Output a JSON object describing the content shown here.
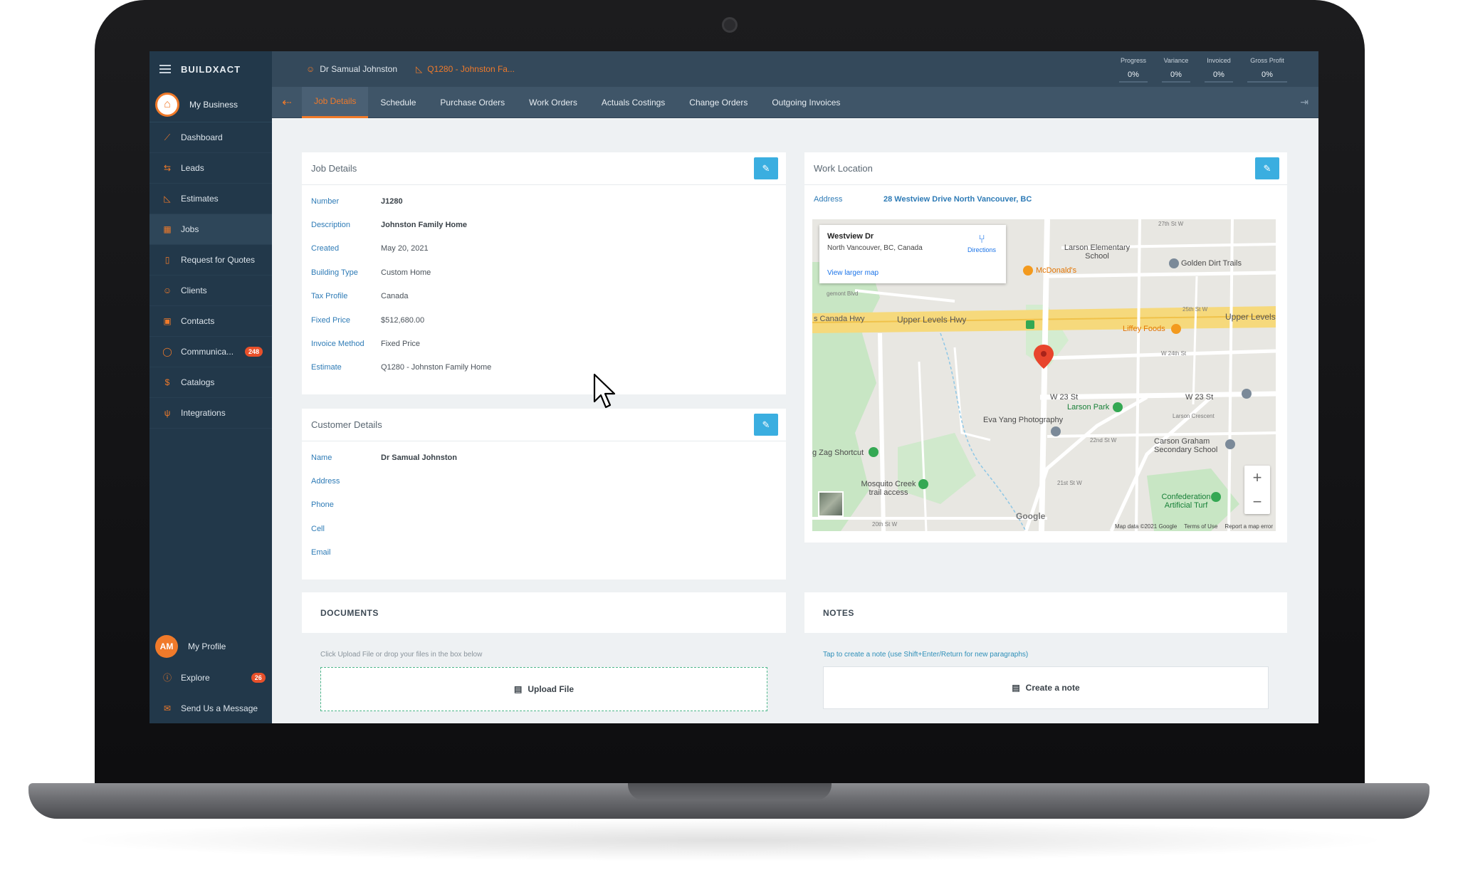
{
  "brand": "BUILDXACT",
  "sidebar": {
    "business_label": "My Business",
    "items": [
      {
        "label": "Dashboard",
        "icon": "chart-line-icon"
      },
      {
        "label": "Leads",
        "icon": "swap-icon"
      },
      {
        "label": "Estimates",
        "icon": "ruler-icon"
      },
      {
        "label": "Jobs",
        "icon": "calendar-icon",
        "active": true
      },
      {
        "label": "Request for Quotes",
        "icon": "document-icon"
      },
      {
        "label": "Clients",
        "icon": "person-icon"
      },
      {
        "label": "Contacts",
        "icon": "address-book-icon"
      },
      {
        "label": "Communica...",
        "icon": "chat-icon",
        "badge": "248"
      },
      {
        "label": "Catalogs",
        "icon": "dollar-icon"
      },
      {
        "label": "Integrations",
        "icon": "plug-icon"
      }
    ],
    "profile": {
      "initials": "AM",
      "label": "My Profile"
    },
    "explore": {
      "label": "Explore",
      "badge": "26"
    },
    "message": {
      "label": "Send Us a Message"
    }
  },
  "topbar": {
    "client_name": "Dr Samual Johnston",
    "job_name": "Q1280 - Johnston Fa...",
    "stats": [
      {
        "label": "Progress",
        "value": "0%"
      },
      {
        "label": "Variance",
        "value": "0%"
      },
      {
        "label": "Invoiced",
        "value": "0%"
      },
      {
        "label": "Gross Profit",
        "value": "0%"
      }
    ]
  },
  "tabs": [
    "Job Details",
    "Schedule",
    "Purchase Orders",
    "Work Orders",
    "Actuals Costings",
    "Change Orders",
    "Outgoing Invoices"
  ],
  "job_details": {
    "title": "Job Details",
    "fields": [
      {
        "label": "Number",
        "value": "J1280",
        "bold": true
      },
      {
        "label": "Description",
        "value": "Johnston Family Home",
        "bold": true
      },
      {
        "label": "Created",
        "value": "May 20, 2021"
      },
      {
        "label": "Building Type",
        "value": "Custom Home"
      },
      {
        "label": "Tax Profile",
        "value": "Canada"
      },
      {
        "label": "Fixed Price",
        "value": "$512,680.00"
      },
      {
        "label": "Invoice Method",
        "value": "Fixed Price"
      },
      {
        "label": "Estimate",
        "value": "Q1280 - Johnston Family Home"
      }
    ]
  },
  "customer_details": {
    "title": "Customer Details",
    "fields": [
      {
        "label": "Name",
        "value": "Dr Samual Johnston",
        "bold": true
      },
      {
        "label": "Address",
        "value": ""
      },
      {
        "label": "Phone",
        "value": ""
      },
      {
        "label": "Cell",
        "value": ""
      },
      {
        "label": "Email",
        "value": ""
      }
    ]
  },
  "work_location": {
    "title": "Work Location",
    "address_label": "Address",
    "address_value": "28 Westview Drive North Vancouver, BC",
    "map": {
      "popup_title": "Westview Dr",
      "popup_subtitle": "North Vancouver, BC, Canada",
      "popup_directions": "Directions",
      "popup_link": "View larger map",
      "labels": {
        "upper_levels_hwy": "Upper Levels Hwy",
        "canada_hwy": "s Canada Hwy",
        "upper_levels_right": "Upper Levels",
        "larson_school": "Larson Elementary School",
        "golden_dirt": "Golden Dirt Trails",
        "mcdonalds": "McDonald's",
        "liffey": "Liffey Foods",
        "larson_park": "Larson Park",
        "eva_yang": "Eva Yang Photography",
        "carson_graham": "Carson Graham Secondary School",
        "zig_zag": "g Zag Shortcut",
        "mosquito": "Mosquito Creek trail access",
        "confederation": "Confederation Artificial Turf",
        "w23": "W 23 St",
        "w23b": "W 23 St",
        "egmont": "gemont Blvd",
        "larson_crescent": "Larson Crescent",
        "w24": "W 24th St",
        "w27": "27th St W",
        "w25": "25th St W",
        "w22": "22nd St W",
        "w21": "21st St W",
        "w20": "20th St W",
        "google": "Google",
        "attribution": "Map data ©2021 Google",
        "terms": "Terms of Use",
        "report": "Report a map error"
      }
    }
  },
  "documents": {
    "title": "DOCUMENTS",
    "hint": "Click Upload File or drop your files in the box below",
    "upload_label": "Upload File"
  },
  "notes": {
    "title": "NOTES",
    "hint": "Tap to create a note (use Shift+Enter/Return for new paragraphs)",
    "create_label": "Create a note"
  },
  "colors": {
    "sidebar_bg": "#22384a",
    "topbar_bg": "#34495b",
    "accent": "#f07a2a",
    "edit_button": "#3aaee0",
    "field_label": "#2e7bb6"
  }
}
